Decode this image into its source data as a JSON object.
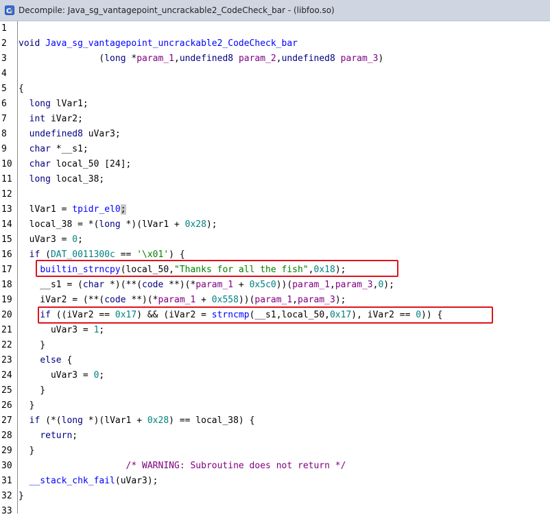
{
  "window": {
    "title": "Decompile: Java_sg_vantagepoint_uncrackable2_CodeCheck_bar -  (libfoo.so)"
  },
  "icons": {
    "title": "decompile-icon"
  },
  "colors": {
    "keyword": "#000080",
    "function": "#0000ff",
    "global": "#008080",
    "param": "#800080",
    "number": "#008080",
    "string": "#008000",
    "comment": "#800080",
    "highlight": "#e0121b"
  },
  "lines": [
    {
      "n": "1",
      "tokens": []
    },
    {
      "n": "2",
      "tokens": [
        [
          "kw",
          "void"
        ],
        [
          "pl",
          " "
        ],
        [
          "fn",
          "Java_sg_vantagepoint_uncrackable2_CodeCheck_bar"
        ]
      ]
    },
    {
      "n": "3",
      "tokens": [
        [
          "pl",
          "               ("
        ],
        [
          "kw",
          "long"
        ],
        [
          "pl",
          " *"
        ],
        [
          "pa",
          "param_1"
        ],
        [
          "pl",
          ","
        ],
        [
          "kw",
          "undefined8"
        ],
        [
          "pl",
          " "
        ],
        [
          "pa",
          "param_2"
        ],
        [
          "pl",
          ","
        ],
        [
          "kw",
          "undefined8"
        ],
        [
          "pl",
          " "
        ],
        [
          "pa",
          "param_3"
        ],
        [
          "pl",
          ")"
        ]
      ]
    },
    {
      "n": "4",
      "tokens": []
    },
    {
      "n": "5",
      "tokens": [
        [
          "pl",
          "{"
        ]
      ]
    },
    {
      "n": "6",
      "tokens": [
        [
          "pl",
          "  "
        ],
        [
          "kw",
          "long"
        ],
        [
          "pl",
          " lVar1;"
        ]
      ]
    },
    {
      "n": "7",
      "tokens": [
        [
          "pl",
          "  "
        ],
        [
          "kw",
          "int"
        ],
        [
          "pl",
          " iVar2;"
        ]
      ]
    },
    {
      "n": "8",
      "tokens": [
        [
          "pl",
          "  "
        ],
        [
          "kw",
          "undefined8"
        ],
        [
          "pl",
          " uVar3;"
        ]
      ]
    },
    {
      "n": "9",
      "tokens": [
        [
          "pl",
          "  "
        ],
        [
          "kw",
          "char"
        ],
        [
          "pl",
          " *__s1;"
        ]
      ]
    },
    {
      "n": "10",
      "tokens": [
        [
          "pl",
          "  "
        ],
        [
          "kw",
          "char"
        ],
        [
          "pl",
          " local_50 [24];"
        ]
      ]
    },
    {
      "n": "11",
      "tokens": [
        [
          "pl",
          "  "
        ],
        [
          "kw",
          "long"
        ],
        [
          "pl",
          " local_38;"
        ]
      ]
    },
    {
      "n": "12",
      "tokens": []
    },
    {
      "n": "13",
      "tokens": [
        [
          "pl",
          "  lVar1 = "
        ],
        [
          "fn",
          "tpidr_el0"
        ],
        [
          "cur",
          ";"
        ]
      ]
    },
    {
      "n": "14",
      "tokens": [
        [
          "pl",
          "  local_38 = *("
        ],
        [
          "kw",
          "long"
        ],
        [
          "pl",
          " *)(lVar1 + "
        ],
        [
          "nu",
          "0x28"
        ],
        [
          "pl",
          ");"
        ]
      ]
    },
    {
      "n": "15",
      "tokens": [
        [
          "pl",
          "  uVar3 = "
        ],
        [
          "nu",
          "0"
        ],
        [
          "pl",
          ";"
        ]
      ]
    },
    {
      "n": "16",
      "tokens": [
        [
          "pl",
          "  "
        ],
        [
          "kw",
          "if"
        ],
        [
          "pl",
          " ("
        ],
        [
          "gl",
          "DAT_0011300c"
        ],
        [
          "pl",
          " == "
        ],
        [
          "st",
          "'\\x01'"
        ],
        [
          "pl",
          ") {"
        ]
      ]
    },
    {
      "n": "17",
      "tokens": [
        [
          "pl",
          "    "
        ],
        [
          "fn",
          "builtin_strncpy"
        ],
        [
          "pl",
          "(local_50,"
        ],
        [
          "st",
          "\"Thanks for all the fish\""
        ],
        [
          "pl",
          ","
        ],
        [
          "nu",
          "0x18"
        ],
        [
          "pl",
          ");"
        ]
      ]
    },
    {
      "n": "18",
      "tokens": [
        [
          "pl",
          "    __s1 = ("
        ],
        [
          "kw",
          "char"
        ],
        [
          "pl",
          " *)(**("
        ],
        [
          "kw",
          "code"
        ],
        [
          "pl",
          " **)(*"
        ],
        [
          "pa",
          "param_1"
        ],
        [
          "pl",
          " + "
        ],
        [
          "nu",
          "0x5c0"
        ],
        [
          "pl",
          "))("
        ],
        [
          "pa",
          "param_1"
        ],
        [
          "pl",
          ","
        ],
        [
          "pa",
          "param_3"
        ],
        [
          "pl",
          ","
        ],
        [
          "nu",
          "0"
        ],
        [
          "pl",
          ");"
        ]
      ]
    },
    {
      "n": "19",
      "tokens": [
        [
          "pl",
          "    iVar2 = (**("
        ],
        [
          "kw",
          "code"
        ],
        [
          "pl",
          " **)(*"
        ],
        [
          "pa",
          "param_1"
        ],
        [
          "pl",
          " + "
        ],
        [
          "nu",
          "0x558"
        ],
        [
          "pl",
          "))("
        ],
        [
          "pa",
          "param_1"
        ],
        [
          "pl",
          ","
        ],
        [
          "pa",
          "param_3"
        ],
        [
          "pl",
          ");"
        ]
      ]
    },
    {
      "n": "20",
      "tokens": [
        [
          "pl",
          "    "
        ],
        [
          "kw",
          "if"
        ],
        [
          "pl",
          " ((iVar2 == "
        ],
        [
          "nu",
          "0x17"
        ],
        [
          "pl",
          ") && (iVar2 = "
        ],
        [
          "fn",
          "strncmp"
        ],
        [
          "pl",
          "(__s1,local_50,"
        ],
        [
          "nu",
          "0x17"
        ],
        [
          "pl",
          "), iVar2 == "
        ],
        [
          "nu",
          "0"
        ],
        [
          "pl",
          ")) {"
        ]
      ]
    },
    {
      "n": "21",
      "tokens": [
        [
          "pl",
          "      uVar3 = "
        ],
        [
          "nu",
          "1"
        ],
        [
          "pl",
          ";"
        ]
      ]
    },
    {
      "n": "22",
      "tokens": [
        [
          "pl",
          "    }"
        ]
      ]
    },
    {
      "n": "23",
      "tokens": [
        [
          "pl",
          "    "
        ],
        [
          "kw",
          "else"
        ],
        [
          "pl",
          " {"
        ]
      ]
    },
    {
      "n": "24",
      "tokens": [
        [
          "pl",
          "      uVar3 = "
        ],
        [
          "nu",
          "0"
        ],
        [
          "pl",
          ";"
        ]
      ]
    },
    {
      "n": "25",
      "tokens": [
        [
          "pl",
          "    }"
        ]
      ]
    },
    {
      "n": "26",
      "tokens": [
        [
          "pl",
          "  }"
        ]
      ]
    },
    {
      "n": "27",
      "tokens": [
        [
          "pl",
          "  "
        ],
        [
          "kw",
          "if"
        ],
        [
          "pl",
          " (*("
        ],
        [
          "kw",
          "long"
        ],
        [
          "pl",
          " *)(lVar1 + "
        ],
        [
          "nu",
          "0x28"
        ],
        [
          "pl",
          ") == local_38) {"
        ]
      ]
    },
    {
      "n": "28",
      "tokens": [
        [
          "pl",
          "    "
        ],
        [
          "kw",
          "return"
        ],
        [
          "pl",
          ";"
        ]
      ]
    },
    {
      "n": "29",
      "tokens": [
        [
          "pl",
          "  }"
        ]
      ]
    },
    {
      "n": "30",
      "tokens": [
        [
          "pl",
          "                    "
        ],
        [
          "cm",
          "/* WARNING: Subroutine does not return */"
        ]
      ]
    },
    {
      "n": "31",
      "tokens": [
        [
          "pl",
          "  "
        ],
        [
          "fn",
          "__stack_chk_fail"
        ],
        [
          "pl",
          "(uVar3);"
        ]
      ]
    },
    {
      "n": "32",
      "tokens": [
        [
          "pl",
          "}"
        ]
      ]
    },
    {
      "n": "33",
      "tokens": []
    }
  ]
}
